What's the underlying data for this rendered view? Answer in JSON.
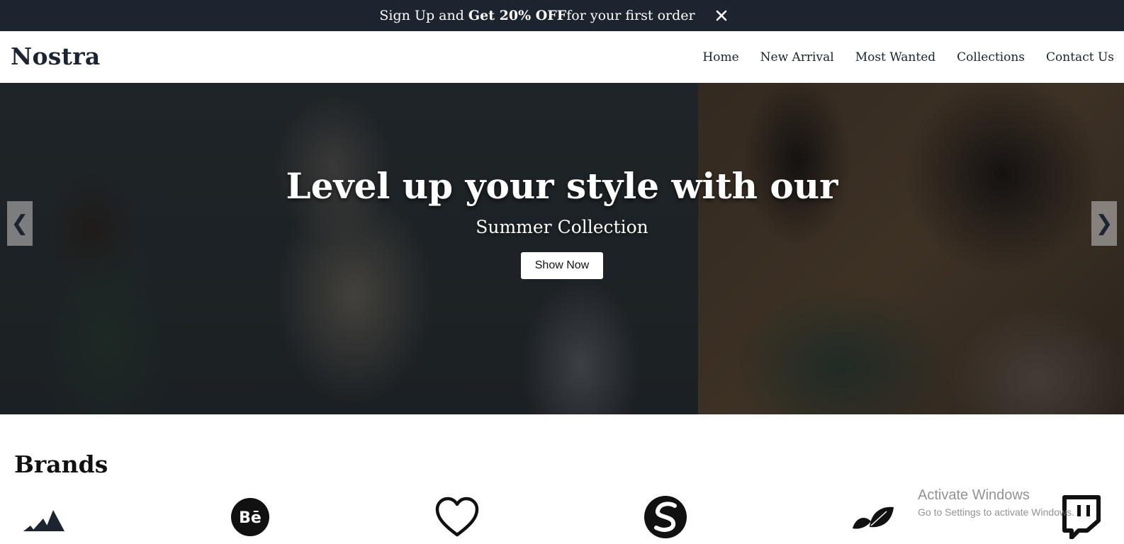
{
  "promo": {
    "text_prefix": "Sign Up and ",
    "text_bold": "Get 20% OFF",
    "text_suffix": "for your first order",
    "close_glyph": "✕"
  },
  "header": {
    "logo": "Nostra",
    "nav": [
      "Home",
      "New Arrival",
      "Most Wanted",
      "Collections",
      "Contact Us"
    ]
  },
  "hero": {
    "title": "Level up your style with our",
    "subtitle": "Summer Collection",
    "button": "Show Now",
    "prev_glyph": "❮",
    "next_glyph": "❯"
  },
  "brands": {
    "title": "Brands",
    "icons": [
      "adidas-icon",
      "behance-icon",
      "heart-icon",
      "squarespace-icon",
      "leaf-icon",
      "twitch-icon"
    ]
  },
  "watermark": {
    "line1": "Activate Windows",
    "line2": "Go to Settings to activate Windows."
  },
  "colors": {
    "promo_bg": "#1c2430",
    "text_dark": "#1b2430"
  }
}
